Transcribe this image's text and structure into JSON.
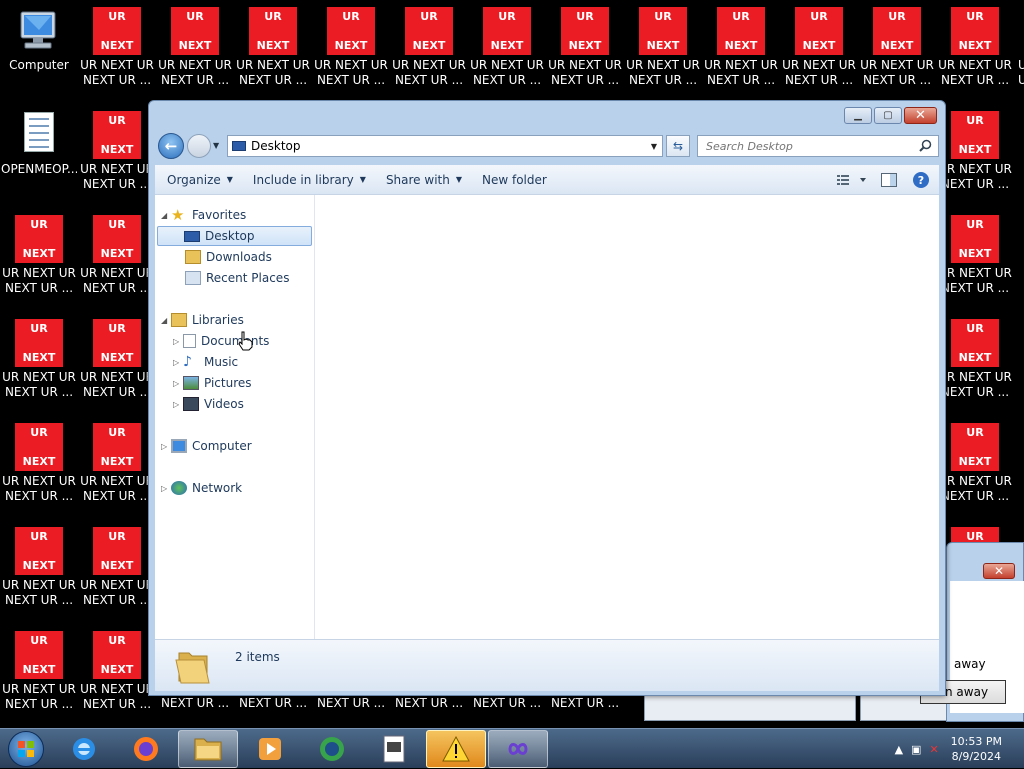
{
  "desktop": {
    "computer_label": "Computer",
    "doc_label": "OPENMEOP...",
    "ur_top": "UR",
    "ur_bottom": "NEXT",
    "ur_label": "UR NEXT UR\nNEXT UR ...",
    "ur_label_short": "NEXT UR ..."
  },
  "explorer": {
    "address": "Desktop",
    "search_placeholder": "Search Desktop",
    "toolbar": {
      "organize": "Organize",
      "include": "Include in library",
      "share": "Share with",
      "new_folder": "New folder"
    },
    "nav": {
      "favorites": "Favorites",
      "desktop": "Desktop",
      "downloads": "Downloads",
      "recent": "Recent Places",
      "libraries": "Libraries",
      "documents": "Documents",
      "music": "Music",
      "pictures": "Pictures",
      "videos": "Videos",
      "computer": "Computer",
      "network": "Network"
    },
    "items_count": "2 items"
  },
  "background_dialog": {
    "text": "away",
    "button": "n away"
  },
  "taskbar": {
    "time": "10:53 PM",
    "date": "8/9/2024"
  },
  "colors": {
    "ur_red": "#ec1c24",
    "window_frame": "#b9d1ea",
    "taskbar": "#2a3f59"
  }
}
